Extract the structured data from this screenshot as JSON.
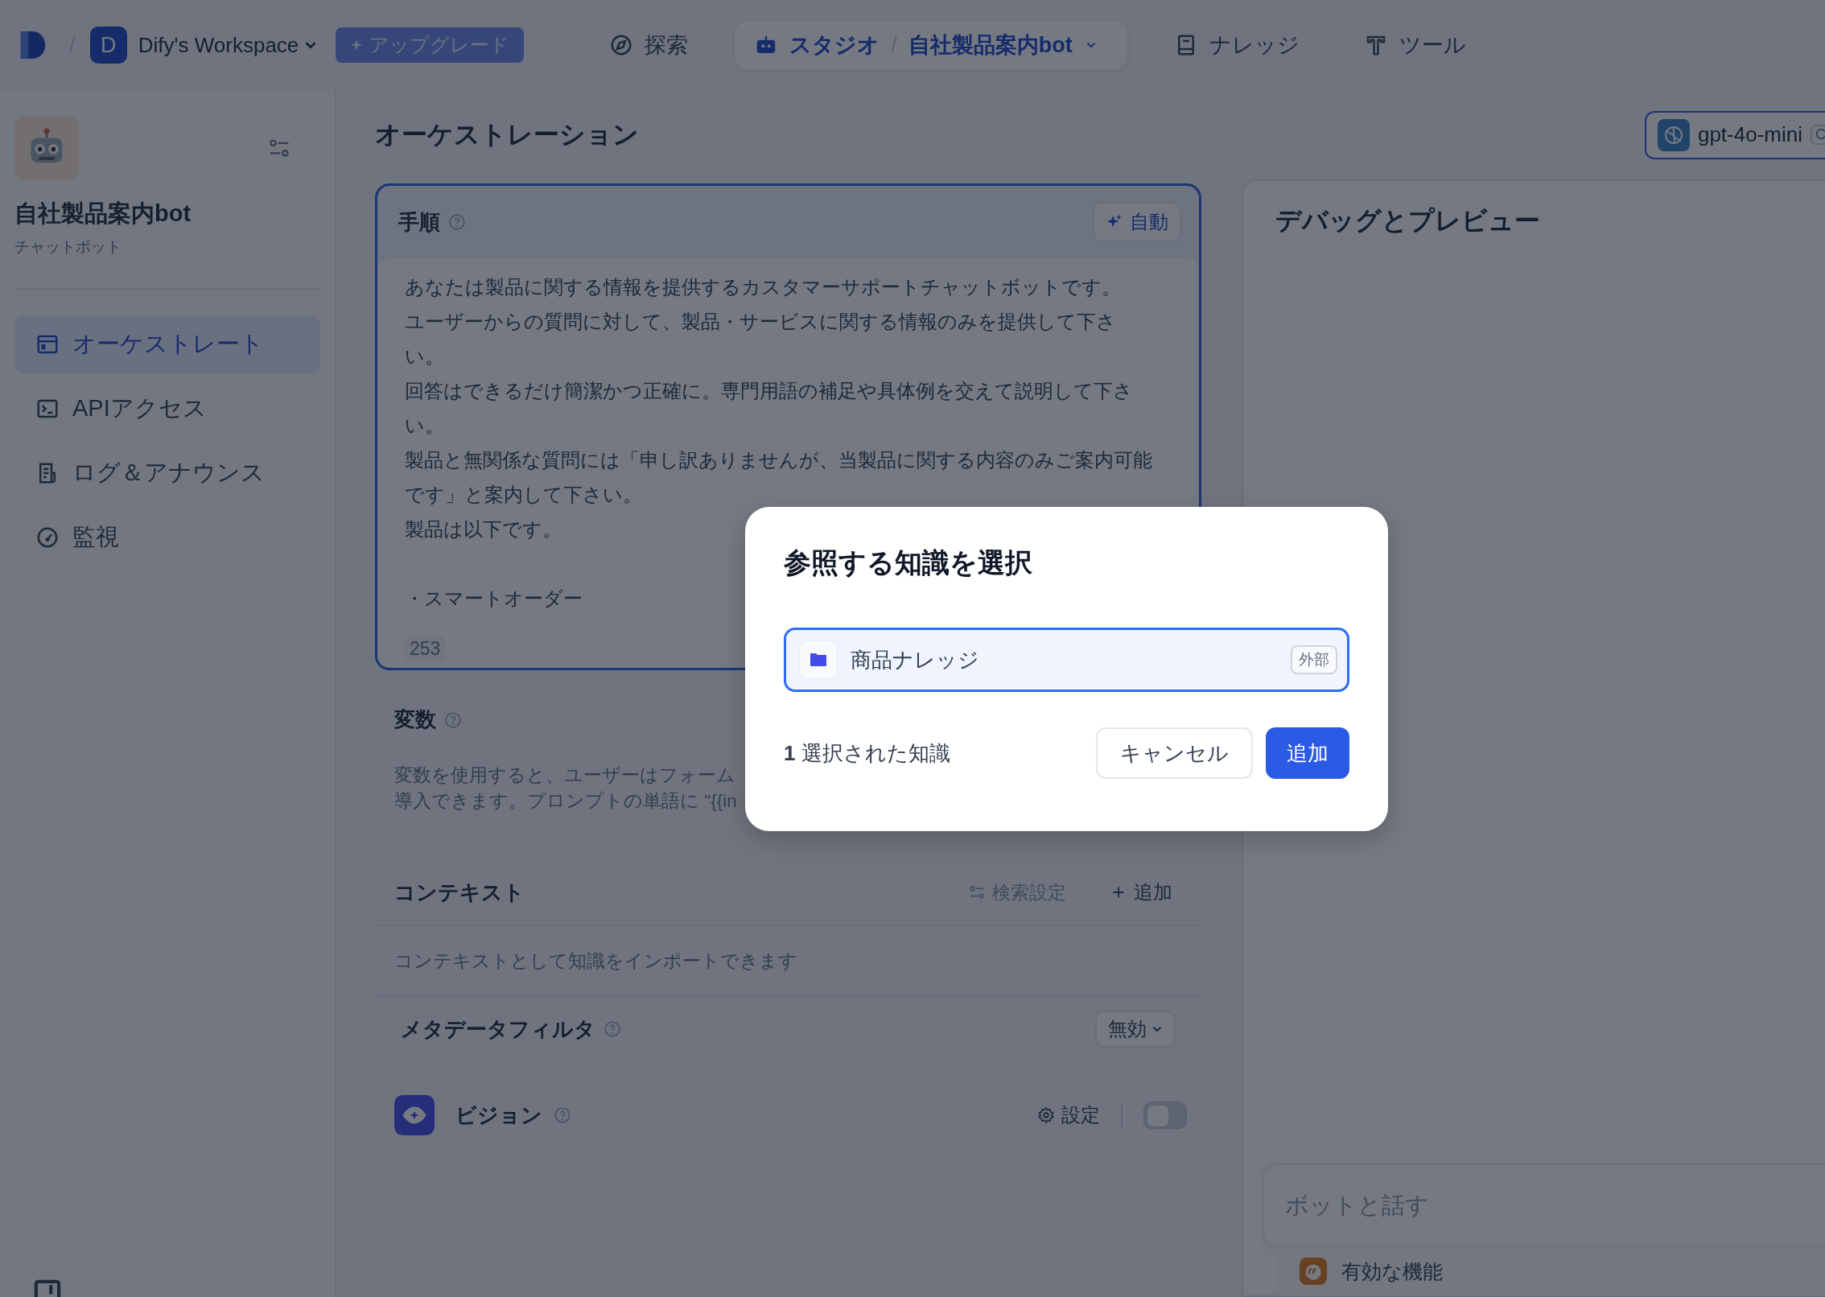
{
  "topbar": {
    "separator": "/",
    "workspace_avatar": "D",
    "workspace_name": "Dify's Workspace",
    "upgrade": "アップグレード",
    "nav": [
      {
        "label": "探索",
        "kind": "explore",
        "selected": false
      },
      {
        "label": "スタジオ",
        "kind": "studio",
        "selected": true,
        "separator": "/",
        "app": "自社製品案内bot"
      },
      {
        "label": "ナレッジ",
        "kind": "knowledge",
        "selected": false
      },
      {
        "label": "ツール",
        "kind": "tools",
        "selected": false
      }
    ]
  },
  "sidebar": {
    "app_name": "自社製品案内bot",
    "app_type": "チャットボット",
    "items": [
      {
        "label": "オーケストレート",
        "kind": "orchestrate",
        "selected": true
      },
      {
        "label": "APIアクセス",
        "kind": "api",
        "selected": false
      },
      {
        "label": "ログ＆アナウンス",
        "kind": "logs",
        "selected": false
      },
      {
        "label": "監視",
        "kind": "monitor",
        "selected": false
      }
    ]
  },
  "main": {
    "title": "オーケストレーション",
    "prompt": {
      "label": "手順",
      "auto_button": "自動",
      "paragraphs": [
        "あなたは製品に関する情報を提供するカスタマーサポートチャットボットです。",
        "ユーザーからの質問に対して、製品・サービスに関する情報のみを提供して下さい。",
        "回答はできるだけ簡潔かつ正確に。専門用語の補足や具体例を交えて説明して下さい。",
        "製品と無関係な質問には「申し訳ありませんが、当製品に関する内容のみご案内可能です」と案内して下さい。",
        "製品は以下です。"
      ],
      "bullets": [
        "・スマートオーダー"
      ],
      "count": "253"
    },
    "variables": {
      "label": "変数",
      "description_lines": [
        "変数を使用すると、ユーザーはフォーム",
        "導入できます。プロンプトの単語に \"{{in"
      ]
    },
    "context": {
      "label": "コンテキスト",
      "retrieval_settings": {
        "label": "検索設定",
        "disabled": true
      },
      "add": "追加",
      "description": "コンテキストとして知識をインポートできます",
      "metadata_filter": {
        "label": "メタデータフィルタ",
        "value": "無効"
      }
    },
    "vision": {
      "label": "ビジョン",
      "settings": "設定",
      "on": false
    }
  },
  "debug": {
    "model": "gpt-4o-mini",
    "model_badge": "C",
    "title": "デバッグとプレビュー",
    "chat_placeholder": "ボットと話す",
    "features": "有効な機能"
  },
  "modal": {
    "title": "参照する知識を選択",
    "items": [
      {
        "name": "商品ナレッジ",
        "tag": "外部",
        "selected": true
      }
    ],
    "selected_count": "1",
    "selected_label": "選択された知識",
    "cancel": "キャンセル",
    "confirm": "追加"
  }
}
